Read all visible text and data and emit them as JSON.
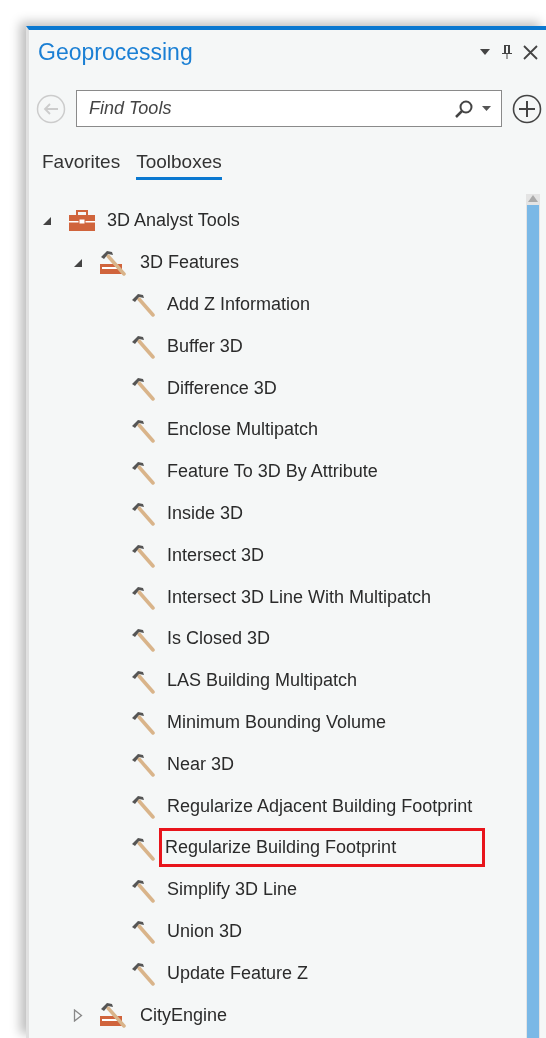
{
  "pane": {
    "title": "Geoprocessing"
  },
  "search": {
    "placeholder": "Find Tools"
  },
  "tabs": [
    {
      "label": "Favorites",
      "selected": false
    },
    {
      "label": "Toolboxes",
      "selected": true
    }
  ],
  "tree": [
    {
      "kind": "toolbox",
      "label": "3D Analyst Tools",
      "expanded": true,
      "children": [
        {
          "kind": "toolset",
          "label": "3D Features",
          "expanded": true,
          "children": [
            {
              "kind": "tool",
              "label": "Add Z Information",
              "highlighted": false
            },
            {
              "kind": "tool",
              "label": "Buffer 3D",
              "highlighted": false
            },
            {
              "kind": "tool",
              "label": "Difference 3D",
              "highlighted": false
            },
            {
              "kind": "tool",
              "label": "Enclose Multipatch",
              "highlighted": false
            },
            {
              "kind": "tool",
              "label": "Feature To 3D By Attribute",
              "highlighted": false
            },
            {
              "kind": "tool",
              "label": "Inside 3D",
              "highlighted": false
            },
            {
              "kind": "tool",
              "label": "Intersect 3D",
              "highlighted": false
            },
            {
              "kind": "tool",
              "label": "Intersect 3D Line With Multipatch",
              "highlighted": false
            },
            {
              "kind": "tool",
              "label": "Is Closed 3D",
              "highlighted": false
            },
            {
              "kind": "tool",
              "label": "LAS Building Multipatch",
              "highlighted": false
            },
            {
              "kind": "tool",
              "label": "Minimum Bounding Volume",
              "highlighted": false
            },
            {
              "kind": "tool",
              "label": "Near 3D",
              "highlighted": false
            },
            {
              "kind": "tool",
              "label": "Regularize Adjacent Building Footprint",
              "highlighted": false
            },
            {
              "kind": "tool",
              "label": "Regularize Building Footprint",
              "highlighted": true
            },
            {
              "kind": "tool",
              "label": "Simplify 3D Line",
              "highlighted": false
            },
            {
              "kind": "tool",
              "label": "Union 3D",
              "highlighted": false
            },
            {
              "kind": "tool",
              "label": "Update Feature Z",
              "highlighted": false
            }
          ]
        },
        {
          "kind": "toolset",
          "label": "CityEngine",
          "expanded": false
        }
      ]
    }
  ]
}
